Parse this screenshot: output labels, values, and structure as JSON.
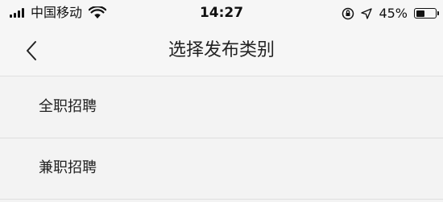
{
  "status_bar": {
    "carrier": "中国移动",
    "time": "14:27",
    "battery_text": "45%",
    "battery_level": 0.45,
    "icons": [
      "signal-icon",
      "wifi-icon",
      "orientation-lock-icon",
      "location-arrow-icon",
      "battery-icon"
    ]
  },
  "nav": {
    "title": "选择发布类别",
    "back_icon": "chevron-left-icon"
  },
  "categories": [
    {
      "label": "全职招聘"
    },
    {
      "label": "兼职招聘"
    }
  ]
}
